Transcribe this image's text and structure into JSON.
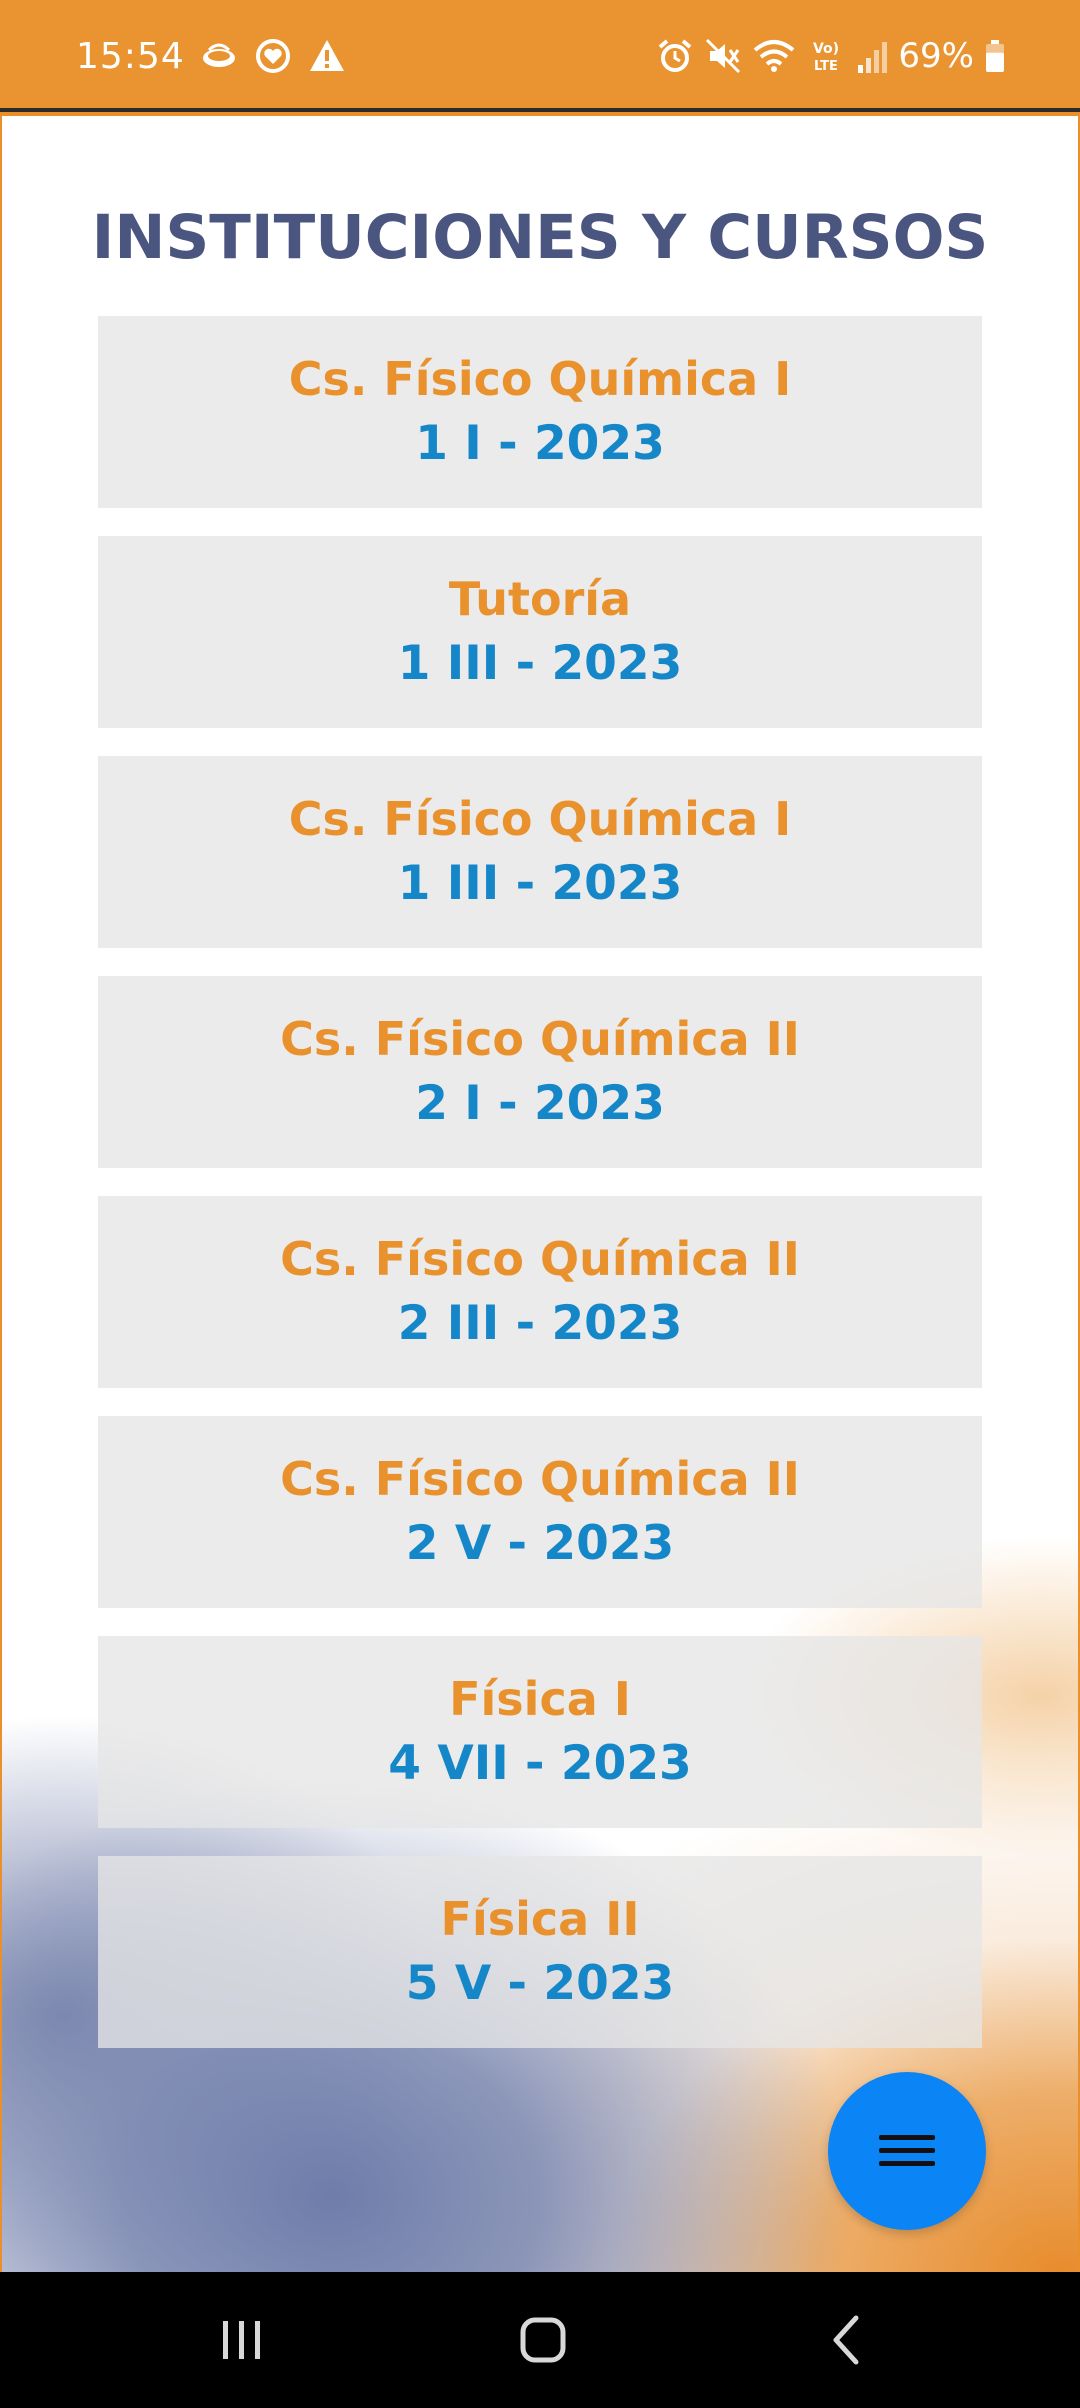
{
  "status_bar": {
    "time": "15:54",
    "battery_percent": "69%",
    "battery_level": 0.69,
    "left_icons": [
      "mate-app-icon",
      "heart-app-icon",
      "warning-icon"
    ],
    "right_icons": [
      "alarm-icon",
      "mute-icon",
      "wifi-icon",
      "volte-icon",
      "signal-icon",
      "battery-icon"
    ]
  },
  "page": {
    "title": "INSTITUCIONES Y CURSOS"
  },
  "courses": [
    {
      "name": "Cs. Físico Química I",
      "group": "1 I - 2023"
    },
    {
      "name": "Tutoría",
      "group": "1 III - 2023"
    },
    {
      "name": "Cs. Físico Química I",
      "group": "1 III - 2023"
    },
    {
      "name": "Cs. Físico Química II",
      "group": "2 I - 2023"
    },
    {
      "name": "Cs. Físico Química II",
      "group": "2 III - 2023"
    },
    {
      "name": "Cs. Físico Química II",
      "group": "2 V - 2023"
    },
    {
      "name": "Física I",
      "group": "4 VII - 2023"
    },
    {
      "name": "Física II",
      "group": "5 V - 2023"
    }
  ],
  "fab": {
    "icon": "menu-icon"
  },
  "nav_bar": {
    "icons": [
      "recent-apps-icon",
      "home-icon",
      "back-icon"
    ]
  },
  "colors": {
    "status_bar": "#e99431",
    "title": "#4a5580",
    "course_name": "#e8912d",
    "course_group": "#1587c9",
    "fab": "#0b84f5"
  }
}
